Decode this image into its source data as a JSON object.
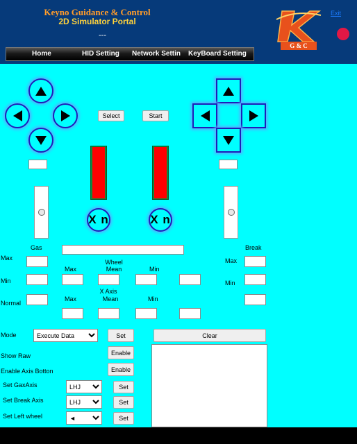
{
  "header": {
    "title": "Keyno Guidance & Control",
    "subtitle": "2D Simulator Portal",
    "dash": "---",
    "exit_label": "Exit",
    "logo_letter": "K",
    "logo_caption": "G & C",
    "colors": {
      "header_bg": "#063a7a",
      "status_dot": "#e21845"
    }
  },
  "menu": {
    "items": [
      {
        "label": "Home"
      },
      {
        "label": "HID Setting"
      },
      {
        "label": "Network Settin"
      },
      {
        "label": "KeyBoard Setting"
      }
    ]
  },
  "controls": {
    "select_label": "Select",
    "start_label": "Start",
    "left_dpad_icons": [
      "up-arrow-icon",
      "left-arrow-icon",
      "right-arrow-icon",
      "down-arrow-icon"
    ],
    "right_dpad_icons": [
      "up-arrow-icon",
      "left-arrow-icon",
      "right-arrow-icon",
      "down-arrow-icon"
    ]
  },
  "axes": {
    "x_button_left": "X n",
    "x_button_right": "X n",
    "left_bar_level": 1.0,
    "right_bar_level": 1.0,
    "gas_slider_level": 0.5,
    "break_slider_level": 0.5
  },
  "stats": {
    "gas_label": "Gas",
    "break_label": "Break",
    "max_label": "Max",
    "min_label": "Min",
    "normal_label": "Normal",
    "wheel_title": "Wheel",
    "x_axis_title": "X Axis",
    "col_max": "Max",
    "col_mean": "Mean",
    "col_min": "Min"
  },
  "settings": {
    "mode_label": "Mode",
    "mode_value": "Execute Data",
    "set_label": "Set",
    "clear_label": "Clear",
    "show_raw_label": "Show Raw",
    "enable_axis_label": "Enable Axis  Botton",
    "enable_label": "Enable",
    "gas_axis_label": "Set GaxAxis",
    "gas_axis_value": "LHJ",
    "break_axis_label": "Set Break Axis",
    "break_axis_value": "LHJ",
    "left_wheel_label": "Set Left wheel",
    "left_wheel_value": "◄"
  }
}
